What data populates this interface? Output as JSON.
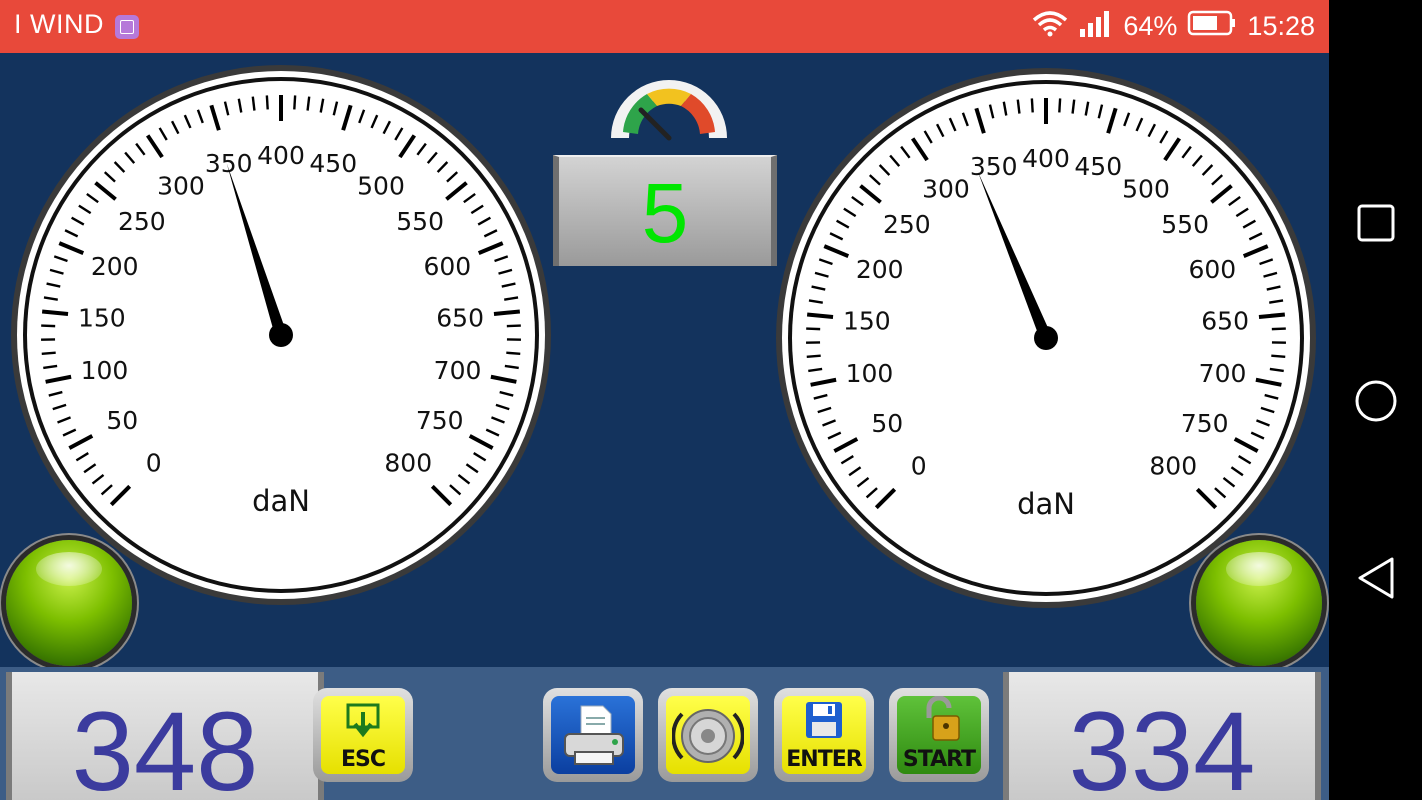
{
  "status_bar": {
    "app_name": "I WIND",
    "battery": "64%",
    "time": "15:28"
  },
  "gauge_scale": {
    "labels": [
      "0",
      "50",
      "100",
      "150",
      "200",
      "250",
      "300",
      "350",
      "400",
      "450",
      "500",
      "550",
      "600",
      "650",
      "700",
      "750",
      "800"
    ],
    "unit": "daN",
    "min": 0,
    "max": 800
  },
  "left_gauge": {
    "value": 348
  },
  "right_gauge": {
    "value": 334
  },
  "center_display": {
    "value": "5"
  },
  "left_readout": {
    "value": "348"
  },
  "right_readout": {
    "value": "334"
  },
  "buttons": {
    "esc": "ESC",
    "print": "print-icon",
    "settings": "gear-wheel-icon",
    "enter": "ENTER",
    "start": "START"
  },
  "colors": {
    "status_bar": "#e8493a",
    "background": "#13335d",
    "bottom_bar": "#3d5d86",
    "digits": "#3b3b9e",
    "center_digit": "#00e600",
    "led": "#7dbf00"
  }
}
